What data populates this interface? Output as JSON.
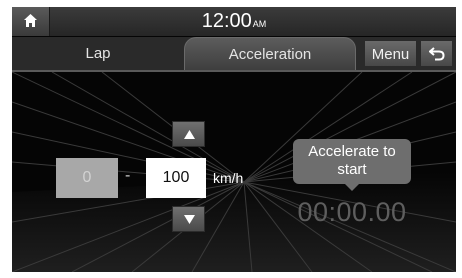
{
  "status_bar": {
    "time": "12:00",
    "ampm": "AM"
  },
  "tabs": [
    {
      "label": "Lap",
      "active": false
    },
    {
      "label": "Acceleration",
      "active": true
    }
  ],
  "toolbar": {
    "menu_label": "Menu"
  },
  "icons": {
    "home": "home-icon",
    "back": "back-arrow-icon",
    "up": "triangle-up-icon",
    "down": "triangle-down-icon"
  },
  "speed_range": {
    "start_value": "0",
    "separator": "-",
    "end_value": "100",
    "unit": "km/h"
  },
  "prompt": {
    "line1": "Accelerate to",
    "line2": "start"
  },
  "timer": {
    "value": "00:00.00"
  },
  "colors": {
    "accent_text": "#ffffff",
    "timer_text": "#5e5e5e",
    "screen_bg": "#050505"
  }
}
